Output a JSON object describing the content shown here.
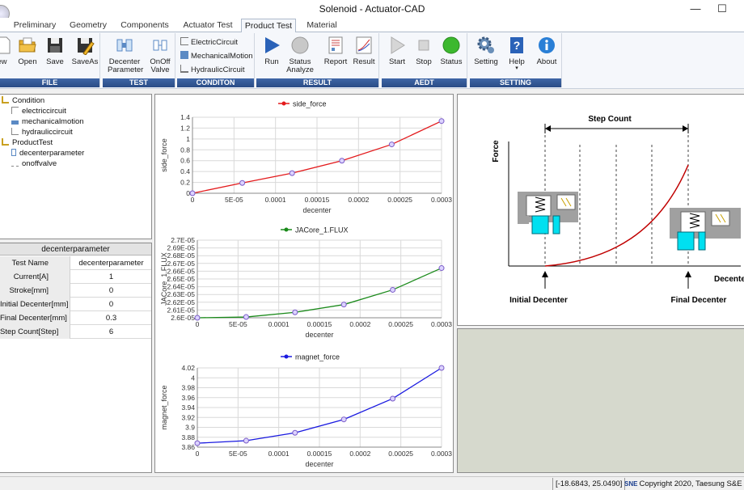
{
  "window": {
    "title": "Solenoid - Actuator-CAD",
    "minimize": "—",
    "maximize": "☐"
  },
  "tabs": [
    "Preliminary",
    "Geometry",
    "Components",
    "Actuator Test",
    "Product Test",
    "Material"
  ],
  "ribbon": {
    "file": {
      "label": "FILE",
      "buttons": [
        "New",
        "Open",
        "Save",
        "SaveAs"
      ]
    },
    "test": {
      "label": "TEST",
      "buttons": [
        "Decenter Parameter",
        "OnOff Valve"
      ]
    },
    "condition": {
      "label": "CONDITON",
      "buttons": [
        "ElectricCircuit",
        "MechanicalMotion",
        "HydraulicCircuit"
      ]
    },
    "result": {
      "label": "RESULT",
      "buttons": [
        "Run",
        "Status Analyze",
        "Report",
        "Result"
      ]
    },
    "aedt": {
      "label": "AEDT",
      "buttons": [
        "Start",
        "Stop",
        "Status"
      ]
    },
    "setting": {
      "label": "SETTING",
      "buttons": [
        "Setting",
        "Help",
        "About"
      ]
    }
  },
  "tree": [
    {
      "label": "Condition"
    },
    {
      "label": "electriccircuit"
    },
    {
      "label": "mechanicalmotion"
    },
    {
      "label": "hydrauliccircuit"
    },
    {
      "label": "ProductTest"
    },
    {
      "label": "decenterparameter"
    },
    {
      "label": "onoffvalve"
    }
  ],
  "properties": {
    "title": "decenterparameter",
    "rows": [
      {
        "key": "Test Name",
        "value": "decenterparameter"
      },
      {
        "key": "Current[A]",
        "value": "1"
      },
      {
        "key": "Stroke[mm]",
        "value": "0"
      },
      {
        "key": "Initial Decenter[mm]",
        "value": "0"
      },
      {
        "key": "Final Decenter[mm]",
        "value": "0.3"
      },
      {
        "key": "Step Count[Step]",
        "value": "6"
      }
    ]
  },
  "chart_data": [
    {
      "type": "line",
      "x": [
        0,
        6e-05,
        0.00012,
        0.00018,
        0.00024,
        0.0003
      ],
      "series": [
        {
          "name": "side_force",
          "values": [
            0,
            0.19,
            0.37,
            0.6,
            0.9,
            1.33
          ],
          "color": "#e31a1c"
        }
      ],
      "xlabel": "decenter",
      "ylabel": "side_force",
      "xlim": [
        0,
        0.0003
      ],
      "ylim": [
        0,
        1.4
      ],
      "xticks": [
        "0",
        "5E-05",
        "0.0001",
        "0.00015",
        "0.0002",
        "0.00025",
        "0.0003"
      ],
      "yticks": [
        "0",
        "0.2",
        "0.4",
        "0.6",
        "0.8",
        "1",
        "1.2",
        "1.4"
      ],
      "grid": true,
      "legend": "top"
    },
    {
      "type": "line",
      "x": [
        0,
        6e-05,
        0.00012,
        0.00018,
        0.00024,
        0.0003
      ],
      "series": [
        {
          "name": "JACore_1.FLUX",
          "values": [
            2.6e-05,
            2.601e-05,
            2.607e-05,
            2.617e-05,
            2.636e-05,
            2.664e-05
          ],
          "color": "#1a8a1a"
        }
      ],
      "xlabel": "decenter",
      "ylabel": "JACore_1.FLUX",
      "xlim": [
        0,
        0.0003
      ],
      "ylim": [
        2.6e-05,
        2.7e-05
      ],
      "xticks": [
        "0",
        "5E-05",
        "0.0001",
        "0.00015",
        "0.0002",
        "0.00025",
        "0.0003"
      ],
      "yticks": [
        "2.6E-05",
        "2.61E-05",
        "2.62E-05",
        "2.63E-05",
        "2.64E-05",
        "2.65E-05",
        "2.66E-05",
        "2.67E-05",
        "2.68E-05",
        "2.69E-05",
        "2.7E-05"
      ],
      "grid": true,
      "legend": "top"
    },
    {
      "type": "line",
      "x": [
        0,
        6e-05,
        0.00012,
        0.00018,
        0.00024,
        0.0003
      ],
      "series": [
        {
          "name": "magnet_force",
          "values": [
            3.868,
            3.873,
            3.889,
            3.916,
            3.958,
            4.02
          ],
          "color": "#1a1ae0"
        }
      ],
      "xlabel": "decenter",
      "ylabel": "magnet_force",
      "xlim": [
        0,
        0.0003
      ],
      "ylim": [
        3.86,
        4.02
      ],
      "xticks": [
        "0",
        "5E-05",
        "0.0001",
        "0.00015",
        "0.0002",
        "0.00025",
        "0.0003"
      ],
      "yticks": [
        "3.86",
        "3.88",
        "3.9",
        "3.92",
        "3.94",
        "3.96",
        "3.98",
        "4",
        "4.02"
      ],
      "grid": true,
      "legend": "top"
    }
  ],
  "diagram": {
    "step_label": "Step Count",
    "y_label": "Force",
    "x_label": "Decenter",
    "initial_label": "Initial Decenter",
    "final_label": "Final Decenter"
  },
  "status": {
    "coords": "[-18.6843, 25.0490]",
    "logo": "SNE",
    "copyright": "Copyright 2020, Taesung S&E"
  }
}
